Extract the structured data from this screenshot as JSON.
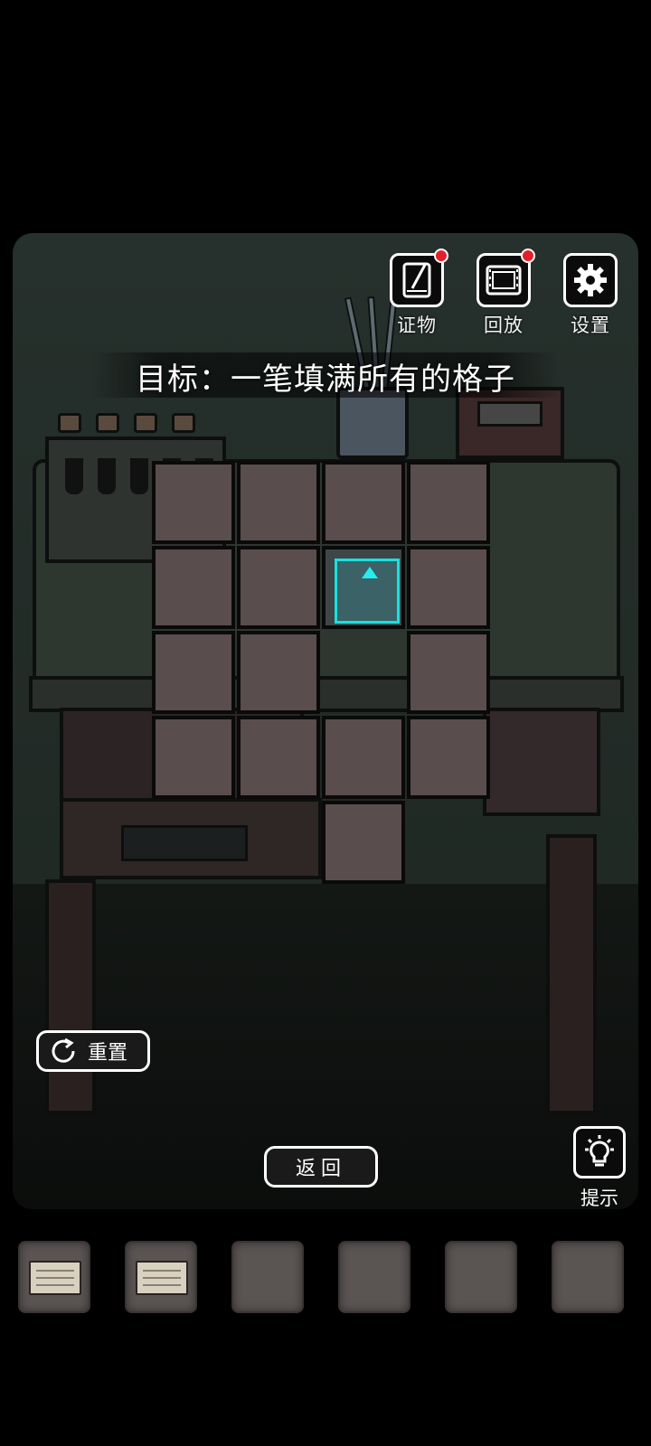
{
  "hud": {
    "evidence": {
      "label": "证物",
      "icon": "evidence-notebook-icon",
      "has_notification": true
    },
    "replay": {
      "label": "回放",
      "icon": "film-reel-icon",
      "has_notification": true
    },
    "settings": {
      "label": "设置",
      "icon": "gear-icon",
      "has_notification": false
    }
  },
  "puzzle": {
    "goal_text": "目标：一笔填满所有的格子",
    "columns": 4,
    "rows": 5,
    "cells": [
      [
        1,
        1,
        1,
        1
      ],
      [
        1,
        1,
        2,
        1
      ],
      [
        1,
        1,
        0,
        1
      ],
      [
        1,
        1,
        1,
        1
      ],
      [
        0,
        0,
        1,
        0
      ]
    ],
    "cursor_direction": "up"
  },
  "controls": {
    "reset_label": "重置",
    "back_label": "返回",
    "hint_label": "提示"
  },
  "inventory": {
    "slots": [
      {
        "filled": true,
        "item": "handwritten-note"
      },
      {
        "filled": true,
        "item": "handwritten-note"
      },
      {
        "filled": false
      },
      {
        "filled": false
      },
      {
        "filled": false
      },
      {
        "filled": false
      }
    ]
  },
  "colors": {
    "cell": "#5a4d4d",
    "cursor_border": "#19e0e0",
    "notification": "#e3202a"
  }
}
